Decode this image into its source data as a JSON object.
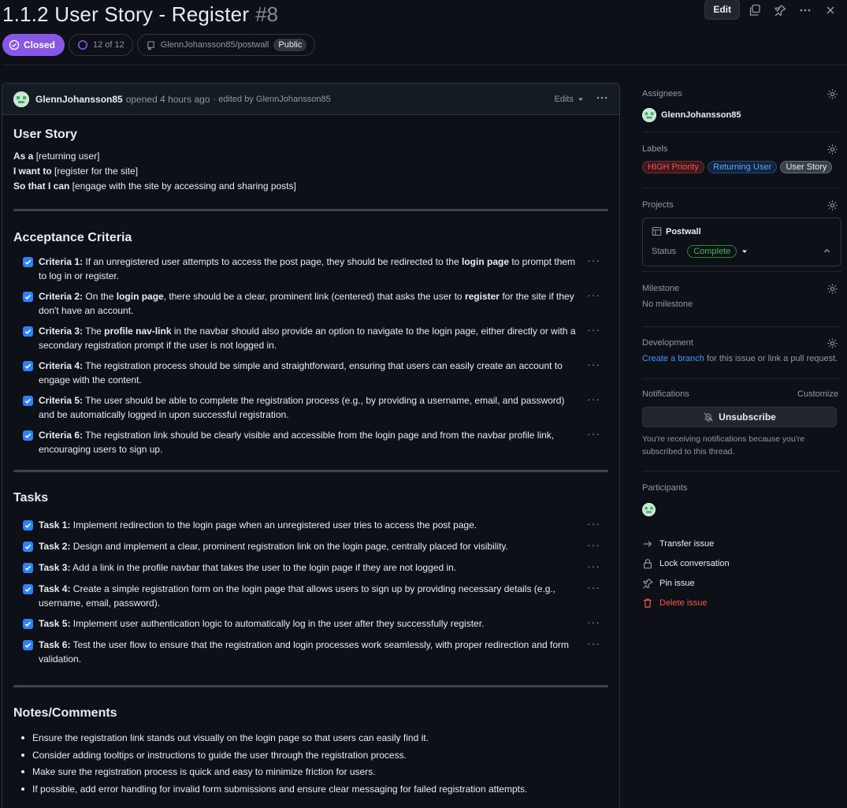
{
  "issue": {
    "title": "1.1.2 User Story - Register",
    "number": "#8",
    "state": "Closed",
    "progress": "12 of 12",
    "progress_fraction": 1.0,
    "repo": "GlennJohansson85/postwall",
    "visibility": "Public"
  },
  "toolbar": {
    "edit_label": "Edit"
  },
  "comment": {
    "author": "GlennJohansson85",
    "opened_text": "opened 4 hours ago",
    "edited_text": "· edited by GlennJohansson85",
    "edits_label": "Edits"
  },
  "user_story": {
    "heading": "User Story",
    "lines": [
      {
        "bold": "As a",
        "text": " [returning user]"
      },
      {
        "bold": "I want to",
        "text": " [register for the site]"
      },
      {
        "bold": "So that I can",
        "text": " [engage with the site by accessing and sharing posts]"
      }
    ]
  },
  "acceptance": {
    "heading": "Acceptance Criteria",
    "items": [
      {
        "label": "Criteria 1:",
        "parts": [
          " If an unregistered user attempts to access the post page, they should be redirected to the ",
          "login page",
          " to prompt them to log in or register."
        ]
      },
      {
        "label": "Criteria 2:",
        "parts": [
          " On the ",
          "login page",
          ", there should be a clear, prominent link (centered) that asks the user to ",
          "register",
          " for the site if they don't have an account."
        ]
      },
      {
        "label": "Criteria 3:",
        "parts": [
          " The ",
          "profile nav-link",
          " in the navbar should also provide an option to navigate to the login page, either directly or with a secondary registration prompt if the user is not logged in."
        ]
      },
      {
        "label": "Criteria 4:",
        "parts": [
          " The registration process should be simple and straightforward, ensuring that users can easily create an account to engage with the content."
        ]
      },
      {
        "label": "Criteria 5:",
        "parts": [
          " The user should be able to complete the registration process (e.g., by providing a username, email, and password) and be automatically logged in upon successful registration."
        ]
      },
      {
        "label": "Criteria 6:",
        "parts": [
          " The registration link should be clearly visible and accessible from the login page and from the navbar profile link, encouraging users to sign up."
        ]
      }
    ]
  },
  "tasks": {
    "heading": "Tasks",
    "items": [
      {
        "label": "Task 1:",
        "text": " Implement redirection to the login page when an unregistered user tries to access the post page."
      },
      {
        "label": "Task 2:",
        "text": " Design and implement a clear, prominent registration link on the login page, centrally placed for visibility."
      },
      {
        "label": "Task 3:",
        "text": " Add a link in the profile navbar that takes the user to the login page if they are not logged in."
      },
      {
        "label": "Task 4:",
        "text": " Create a simple registration form on the login page that allows users to sign up by providing necessary details (e.g., username, email, password)."
      },
      {
        "label": "Task 5:",
        "text": " Implement user authentication logic to automatically log in the user after they successfully register."
      },
      {
        "label": "Task 6:",
        "text": " Test the user flow to ensure that the registration and login processes work seamlessly, with proper redirection and form validation."
      }
    ]
  },
  "notes": {
    "heading": "Notes/Comments",
    "items": [
      "Ensure the registration link stands out visually on the login page so that users can easily find it.",
      "Consider adding tooltips or instructions to guide the user through the registration process.",
      "Make sure the registration process is quick and easy to minimize friction for users.",
      "If possible, add error handling for invalid form submissions and ensure clear messaging for failed registration attempts."
    ]
  },
  "sidebar": {
    "assignees": {
      "title": "Assignees",
      "user": "GlennJohansson85"
    },
    "labels": {
      "title": "Labels",
      "items": [
        {
          "name": "HIGH Priority",
          "color": "#f85149",
          "bg": "#3a1a1e"
        },
        {
          "name": "Returning User",
          "color": "#58a6ff",
          "bg": "#14233a"
        },
        {
          "name": "User Story",
          "color": "#e6edf3",
          "bg": "#3a4049"
        }
      ]
    },
    "projects": {
      "title": "Projects",
      "name": "Postwall",
      "status_label": "Status",
      "status_value": "Complete"
    },
    "milestone": {
      "title": "Milestone",
      "value": "No milestone"
    },
    "development": {
      "title": "Development",
      "link": "Create a branch",
      "rest": " for this issue or link a pull request."
    },
    "notifications": {
      "title": "Notifications",
      "customize": "Customize",
      "button": "Unsubscribe",
      "note": "You're receiving notifications because you're subscribed to this thread."
    },
    "participants": {
      "title": "Participants"
    },
    "actions": {
      "transfer": "Transfer issue",
      "lock": "Lock conversation",
      "pin": "Pin issue",
      "delete": "Delete issue"
    }
  },
  "colors": {
    "bg": "#0d1117",
    "closed": "#8957e5",
    "accent": "#2f81f7",
    "danger": "#f85149",
    "complete": "#3fb950"
  }
}
